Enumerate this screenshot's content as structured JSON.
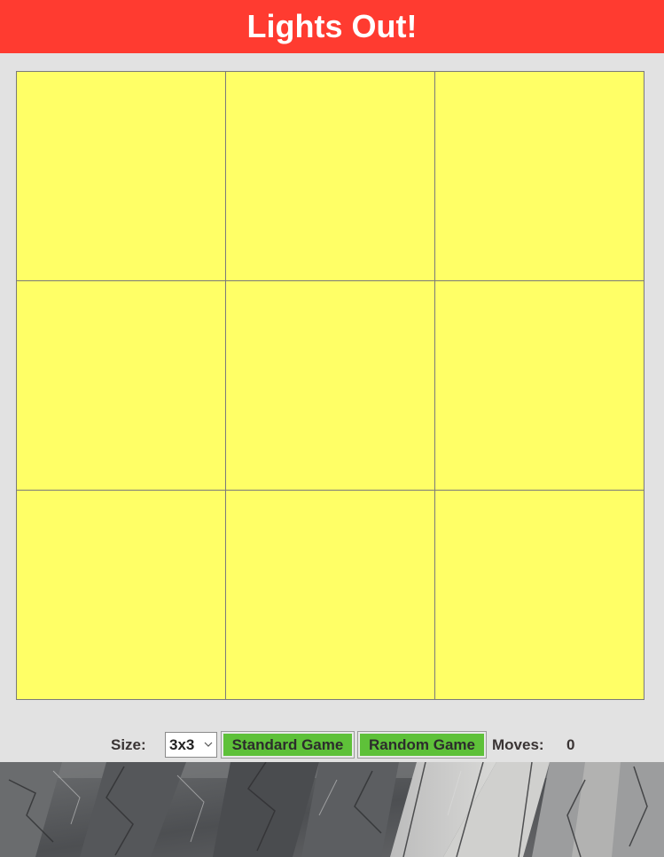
{
  "header": {
    "title": "Lights Out!"
  },
  "board": {
    "size": 3,
    "lit_color": "#ffff66",
    "off_color": "#4a4a4a",
    "cells": [
      [
        true,
        true,
        true
      ],
      [
        true,
        true,
        true
      ],
      [
        true,
        true,
        true
      ]
    ]
  },
  "controls": {
    "size_label": "Size:",
    "size_value": "3x3",
    "standard_label": "Standard Game",
    "random_label": "Random Game",
    "moves_label": "Moves:",
    "moves_value": "0"
  },
  "colors": {
    "header_bg": "#ff3b30",
    "page_bg": "#e2e2e2",
    "button_bg": "#5ec139"
  },
  "footer": {
    "image": "granite-rock-background"
  }
}
